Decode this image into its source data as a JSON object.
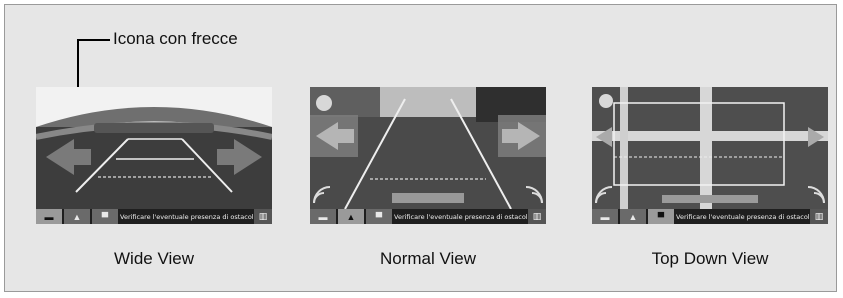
{
  "callout": {
    "label": "Icona con frecce"
  },
  "views": [
    {
      "caption": "Wide View",
      "message": "Verificare l'eventuale presenza di ostacoli"
    },
    {
      "caption": "Normal View",
      "message": "Verificare l'eventuale presenza di ostacoli"
    },
    {
      "caption": "Top Down View",
      "message": "Verificare l'eventuale presenza di ostacoli"
    }
  ],
  "icons": [
    "camera-mode-button-icon",
    "arrow-guide-icon",
    "sensor-wave-icon"
  ],
  "colors": {
    "panel_bg": "#e6e6e6",
    "panel_border": "#9a9a9a",
    "screen_bg": "#2e2e2e"
  }
}
